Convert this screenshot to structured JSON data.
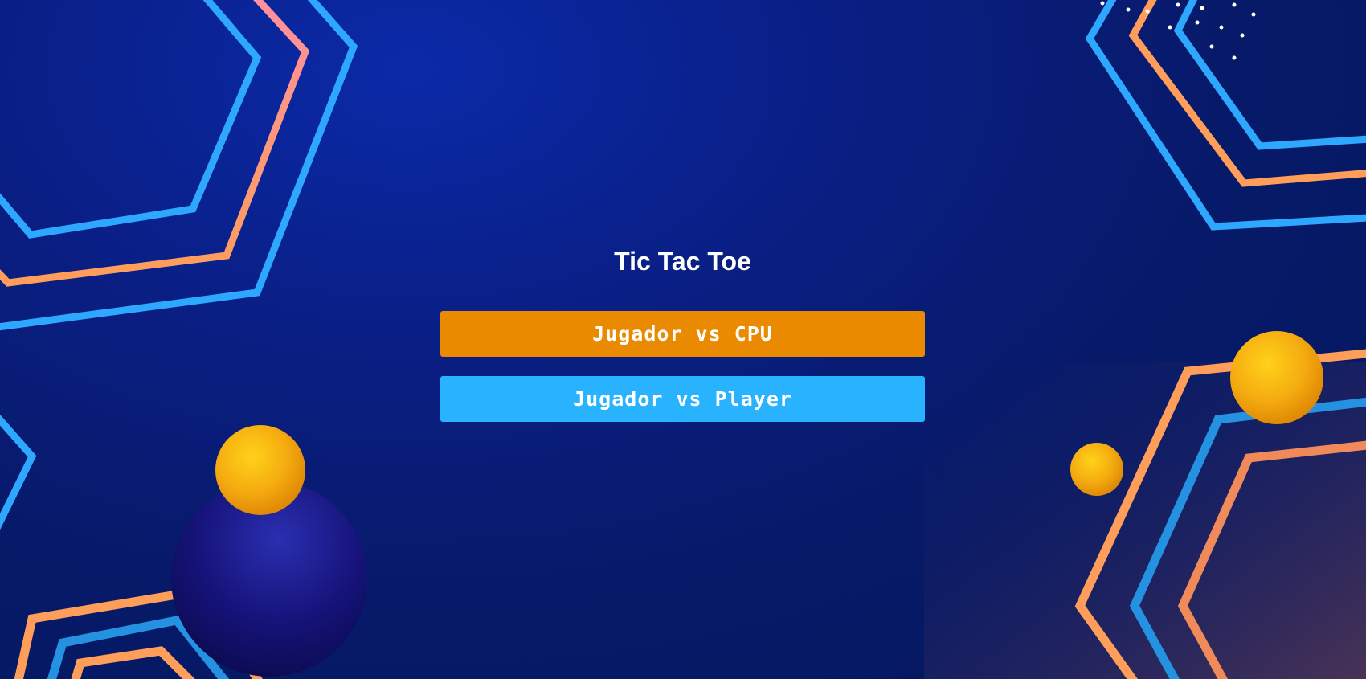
{
  "title": "Tic Tac Toe",
  "buttons": {
    "vs_cpu": "Jugador vs CPU",
    "vs_player": "Jugador vs Player"
  },
  "colors": {
    "background": "#071a6a",
    "orange_button": "#ea8a00",
    "blue_button": "#29b3ff",
    "accent_blue": "#2ea8ff",
    "accent_orange": "#ff9e5a",
    "ball": "#f5ac10"
  }
}
